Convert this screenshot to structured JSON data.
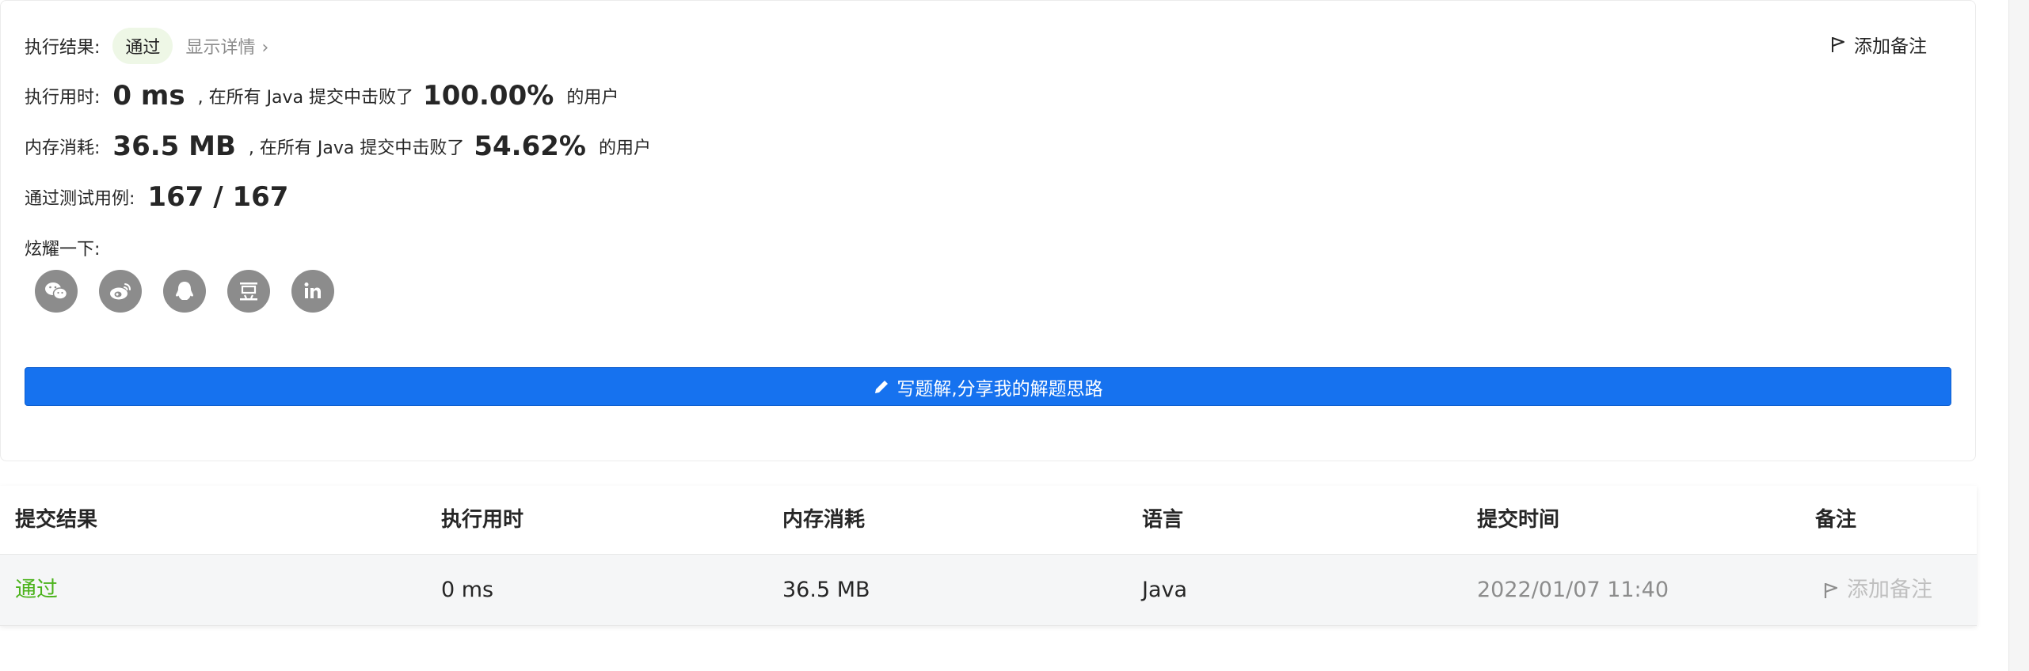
{
  "result": {
    "label": "执行结果:",
    "status": "通过",
    "details_link": "显示详情",
    "add_note": "添加备注"
  },
  "runtime": {
    "label": "执行用时:",
    "value": "0 ms",
    "middle_text": ", 在所有 Java 提交中击败了",
    "percent": "100.00%",
    "suffix": "的用户"
  },
  "memory": {
    "label": "内存消耗:",
    "value": "36.5 MB",
    "middle_text": ", 在所有 Java 提交中击败了",
    "percent": "54.62%",
    "suffix": "的用户"
  },
  "testcases": {
    "label": "通过测试用例:",
    "value": "167 / 167"
  },
  "share": {
    "label": "炫耀一下:",
    "icons": [
      "wechat-icon",
      "weibo-icon",
      "qq-icon",
      "douban-icon",
      "linkedin-icon"
    ]
  },
  "write_button": {
    "label": "写题解,分享我的解题思路",
    "color": "#1672ef"
  },
  "table": {
    "headers": [
      "提交结果",
      "执行用时",
      "内存消耗",
      "语言",
      "提交时间",
      "备注"
    ],
    "rows": [
      {
        "status": "通过",
        "runtime": "0 ms",
        "memory": "36.5 MB",
        "language": "Java",
        "submitted_at": "2022/01/07 11:40",
        "note": "添加备注"
      }
    ]
  },
  "colors": {
    "pass_green": "#4bb31b",
    "pill_bg": "#eef7e6",
    "muted": "#8c8c8c"
  }
}
